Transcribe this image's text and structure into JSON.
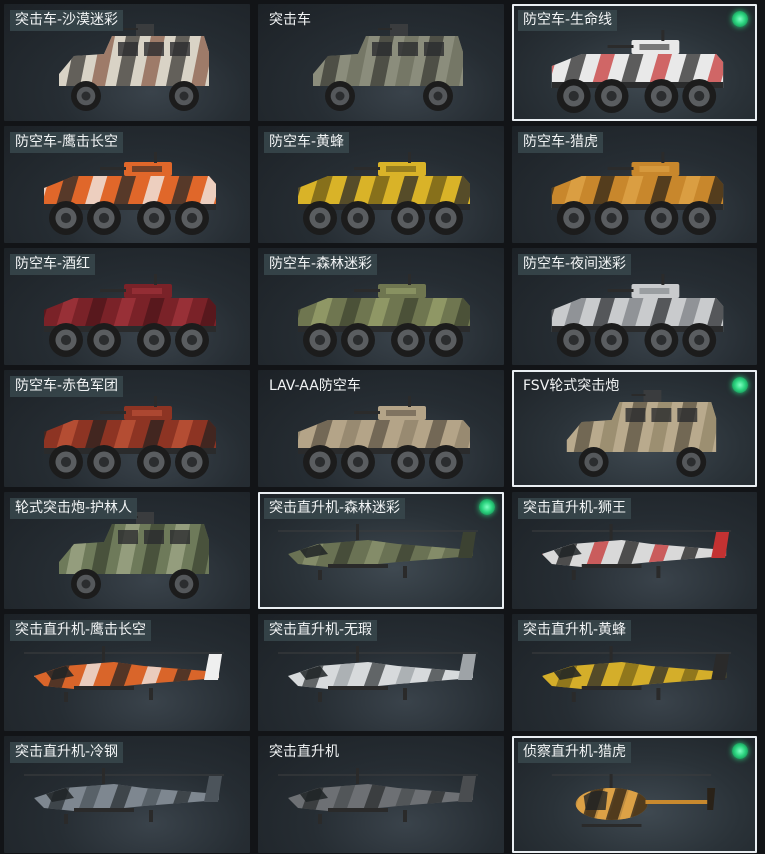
{
  "tiles": [
    {
      "label": "突击车-沙漠迷彩",
      "tag": true,
      "selected": false,
      "check": false,
      "kind": "truck",
      "camo": [
        "#d9d3c6",
        "#8a5d4a",
        "#3b3a36"
      ]
    },
    {
      "label": "突击车",
      "tag": false,
      "selected": false,
      "check": false,
      "kind": "truck",
      "camo": [
        "#8b8d7c",
        "#6e705f",
        "#3a3b34"
      ]
    },
    {
      "label": "防空车-生命线",
      "tag": true,
      "selected": true,
      "check": true,
      "kind": "apc",
      "camo": [
        "#e9e9e9",
        "#c73a3a",
        "#2c2c2c"
      ]
    },
    {
      "label": "防空车-鹰击长空",
      "tag": true,
      "selected": false,
      "check": false,
      "kind": "apc",
      "camo": [
        "#e0672a",
        "#f2f2f2",
        "#2a2a2a"
      ]
    },
    {
      "label": "防空车-黄蜂",
      "tag": true,
      "selected": false,
      "check": false,
      "kind": "apc",
      "camo": [
        "#d9b328",
        "#2a2a2a",
        "#6b5a17"
      ]
    },
    {
      "label": "防空车-猎虎",
      "tag": true,
      "selected": false,
      "check": false,
      "kind": "apc",
      "camo": [
        "#c8872c",
        "#2d2418",
        "#e0a54a"
      ]
    },
    {
      "label": "防空车-酒红",
      "tag": true,
      "selected": false,
      "check": false,
      "kind": "apc",
      "camo": [
        "#7a2228",
        "#4d1519",
        "#a3353c"
      ]
    },
    {
      "label": "防空车-森林迷彩",
      "tag": true,
      "selected": false,
      "check": false,
      "kind": "apc",
      "camo": [
        "#6f7650",
        "#3f4530",
        "#9aa36c"
      ]
    },
    {
      "label": "防空车-夜间迷彩",
      "tag": true,
      "selected": false,
      "check": false,
      "kind": "apc",
      "camo": [
        "#c9cbcd",
        "#2e3033",
        "#7c8084"
      ]
    },
    {
      "label": "防空车-赤色军团",
      "tag": true,
      "selected": false,
      "check": false,
      "kind": "apc",
      "camo": [
        "#8d3423",
        "#2a2220",
        "#c2553a"
      ]
    },
    {
      "label": "LAV-AA防空车",
      "tag": false,
      "selected": false,
      "check": false,
      "kind": "apc",
      "camo": [
        "#b4a488",
        "#8f816a",
        "#5d5446"
      ]
    },
    {
      "label": "FSV轮式突击炮",
      "tag": false,
      "selected": true,
      "check": true,
      "kind": "truck",
      "camo": [
        "#b9aa8d",
        "#938568",
        "#5b5241"
      ]
    },
    {
      "label": "轮式突击炮-护林人",
      "tag": true,
      "selected": false,
      "check": false,
      "kind": "truck",
      "camo": [
        "#6e7a5a",
        "#3d4533",
        "#a1a98a"
      ]
    },
    {
      "label": "突击直升机-森林迷彩",
      "tag": true,
      "selected": true,
      "check": true,
      "kind": "heli",
      "camo": [
        "#6a7254",
        "#3c4232",
        "#8e9670"
      ]
    },
    {
      "label": "突击直升机-狮王",
      "tag": true,
      "selected": false,
      "check": false,
      "kind": "heli",
      "camo": [
        "#d9d9d9",
        "#c43232",
        "#1e1e1e"
      ]
    },
    {
      "label": "突击直升机-鹰击长空",
      "tag": true,
      "selected": false,
      "check": false,
      "kind": "heli",
      "camo": [
        "#d9652a",
        "#efefef",
        "#262626"
      ]
    },
    {
      "label": "突击直升机-无瑕",
      "tag": true,
      "selected": false,
      "check": false,
      "kind": "heli",
      "camo": [
        "#d7dadc",
        "#9ea3a7",
        "#3a3d40"
      ]
    },
    {
      "label": "突击直升机-黄蜂",
      "tag": true,
      "selected": false,
      "check": false,
      "kind": "heli",
      "camo": [
        "#d4ae2a",
        "#2a2a2a",
        "#7a6418"
      ]
    },
    {
      "label": "突击直升机-冷钢",
      "tag": true,
      "selected": false,
      "check": false,
      "kind": "heli",
      "camo": [
        "#7e8790",
        "#4c545b",
        "#2a2f33"
      ]
    },
    {
      "label": "突击直升机",
      "tag": false,
      "selected": false,
      "check": false,
      "kind": "heli",
      "camo": [
        "#6d7074",
        "#4a4d50",
        "#2b2d2f"
      ]
    },
    {
      "label": "侦察直升机-猎虎",
      "tag": true,
      "selected": true,
      "check": true,
      "kind": "scout",
      "camo": [
        "#c8892e",
        "#2a2218",
        "#e3a94f"
      ]
    }
  ]
}
